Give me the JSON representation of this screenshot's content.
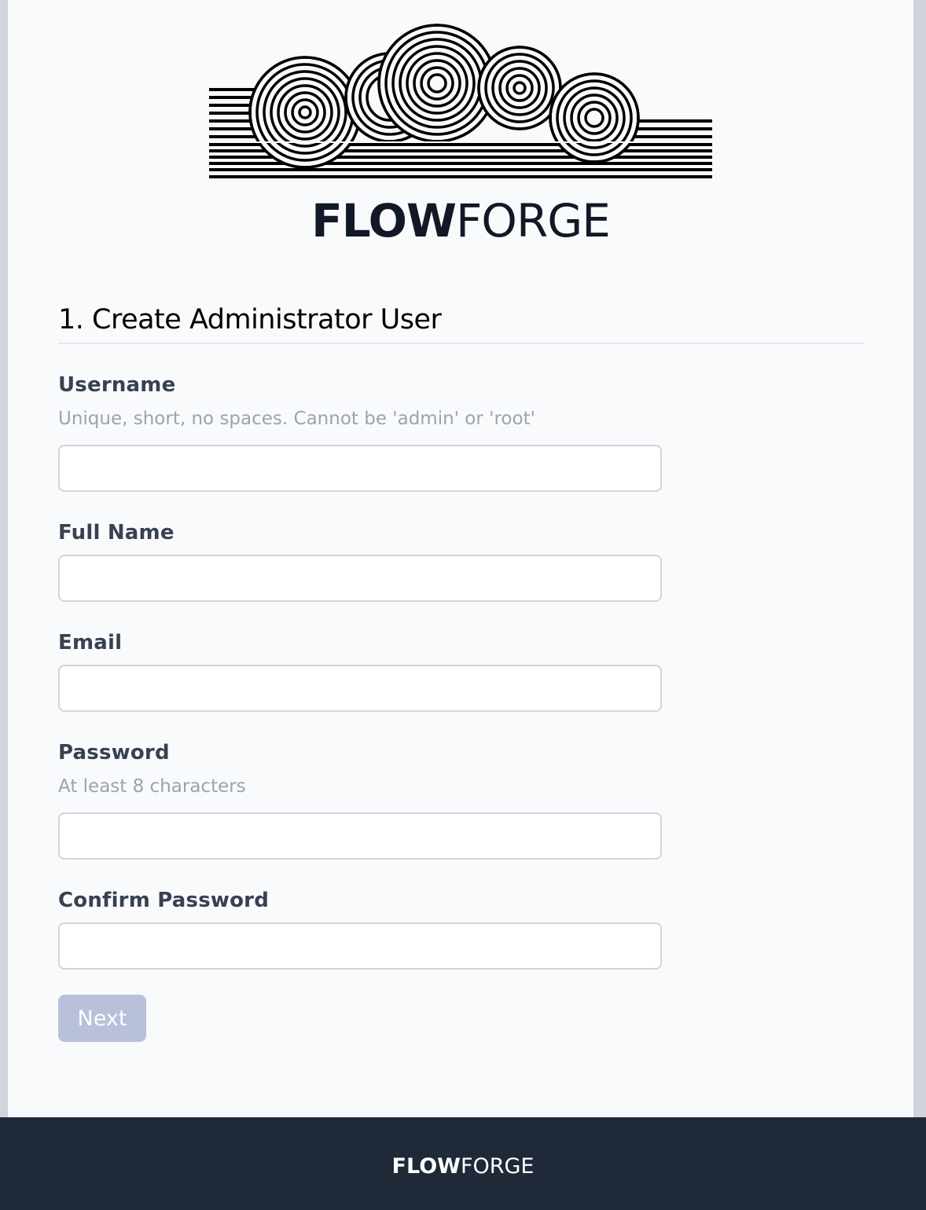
{
  "brand": {
    "bold": "FLOW",
    "light": "FORGE",
    "logo_icon": "cloud-swirl-logo-icon"
  },
  "section": {
    "title": "1. Create Administrator User"
  },
  "fields": {
    "username": {
      "label": "Username",
      "hint": "Unique, short, no spaces. Cannot be 'admin' or 'root'",
      "value": "",
      "placeholder": ""
    },
    "full_name": {
      "label": "Full Name",
      "value": "",
      "placeholder": ""
    },
    "email": {
      "label": "Email",
      "value": "",
      "placeholder": ""
    },
    "password": {
      "label": "Password",
      "hint": "At least 8 characters",
      "value": "",
      "placeholder": ""
    },
    "confirm_password": {
      "label": "Confirm Password",
      "value": "",
      "placeholder": ""
    }
  },
  "actions": {
    "next_label": "Next",
    "next_enabled": false
  },
  "footer": {
    "bold": "FLOW",
    "light": "FORGE"
  },
  "colors": {
    "footer_bg": "#1f2937",
    "page_bg": "#f8fafc",
    "button_disabled": "#b9c0d9"
  }
}
